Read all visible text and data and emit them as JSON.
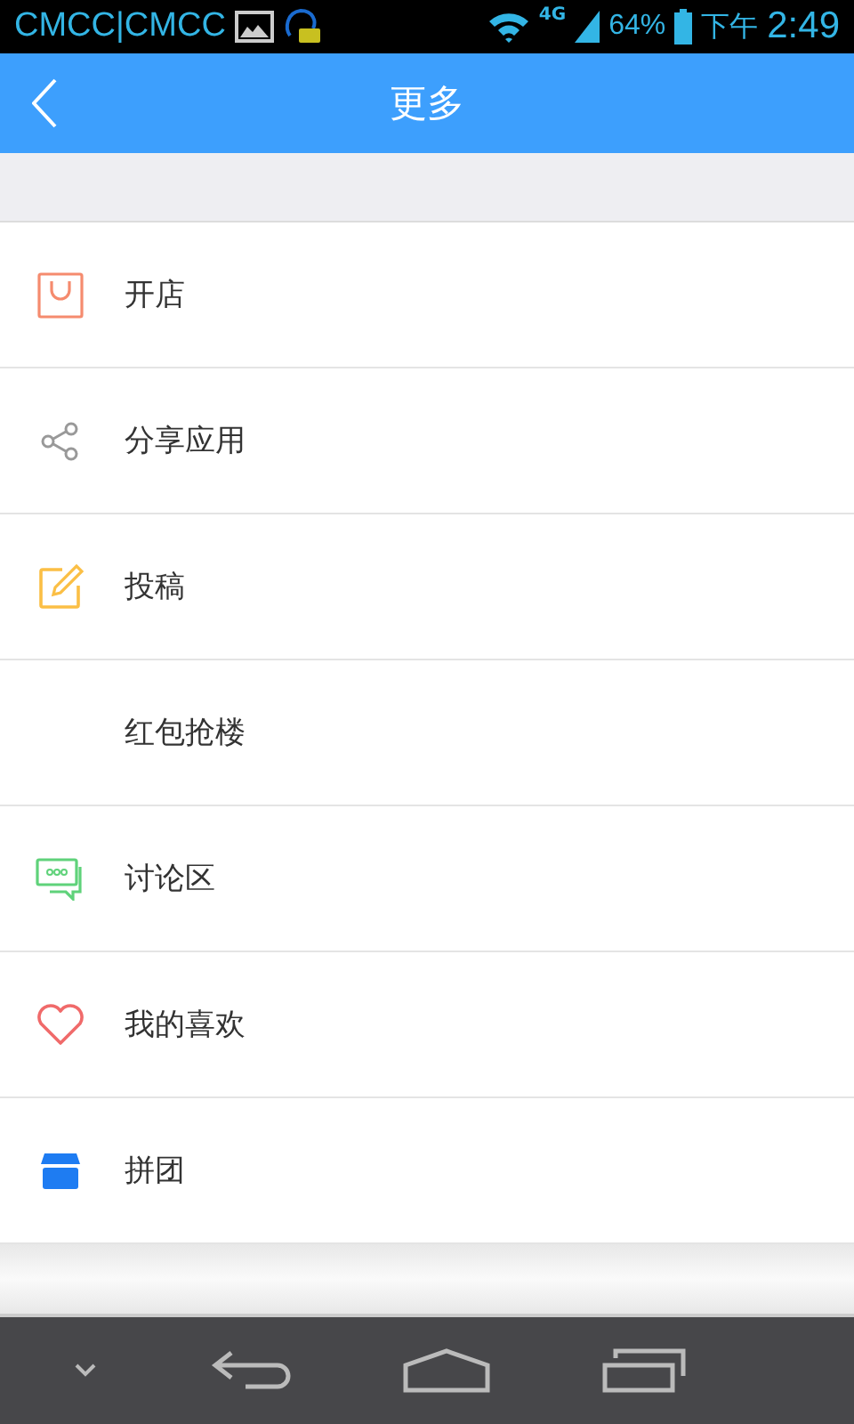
{
  "status_bar": {
    "carrier": "CMCC|CMCC",
    "network": "4G",
    "battery": "64%",
    "time_period": "下午",
    "time": "2:49"
  },
  "header": {
    "title": "更多"
  },
  "menu": [
    {
      "kind": "bag",
      "label": "开店"
    },
    {
      "kind": "share",
      "label": "分享应用"
    },
    {
      "kind": "edit",
      "label": "投稿"
    },
    {
      "kind": "plain",
      "label": "红包抢楼"
    },
    {
      "kind": "chat",
      "label": "讨论区"
    },
    {
      "kind": "heart",
      "label": "我的喜欢"
    },
    {
      "kind": "store",
      "label": "拼团"
    }
  ]
}
